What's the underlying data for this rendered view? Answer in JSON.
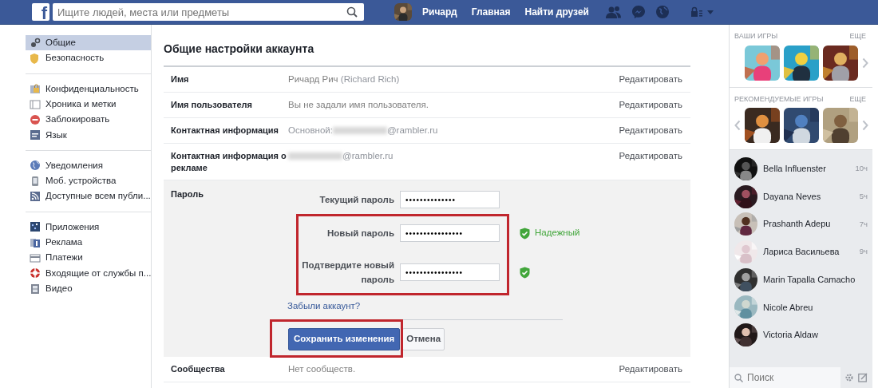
{
  "topbar": {
    "logo": "f",
    "search": {
      "placeholder": "Ищите людей, места или предметы"
    },
    "user": "Ричард",
    "links": [
      "Главная",
      "Найти друзей"
    ]
  },
  "sidebar": {
    "groups": [
      [
        {
          "label": "Общие",
          "selected": true
        },
        {
          "label": "Безопасность",
          "selected": false
        }
      ],
      [
        {
          "label": "Конфиденциальность",
          "selected": false
        },
        {
          "label": "Хроника и метки",
          "selected": false
        },
        {
          "label": "Заблокировать",
          "selected": false
        },
        {
          "label": "Язык",
          "selected": false
        }
      ],
      [
        {
          "label": "Уведомления",
          "selected": false
        },
        {
          "label": "Моб. устройства",
          "selected": false
        },
        {
          "label": "Доступные всем публи...",
          "selected": false
        }
      ],
      [
        {
          "label": "Приложения",
          "selected": false
        },
        {
          "label": "Реклама",
          "selected": false
        },
        {
          "label": "Платежи",
          "selected": false
        },
        {
          "label": "Входящие от службы п...",
          "selected": false
        },
        {
          "label": "Видео",
          "selected": false
        }
      ]
    ]
  },
  "settings": {
    "title": "Общие настройки аккаунта",
    "rows": [
      {
        "label": "Имя",
        "value": "Ричард Рич",
        "note": "(Richard Rich)",
        "action": "Редактировать"
      },
      {
        "label": "Имя пользователя",
        "value": "Вы не задали имя пользователя.",
        "action": "Редактировать"
      },
      {
        "label": "Контактная информация",
        "prefix": "Основной:",
        "redacted": true,
        "suffix": "@rambler.ru",
        "action": "Редактировать"
      },
      {
        "label": "Контактная информация о рекламе",
        "redacted": true,
        "suffix": "@rambler.ru",
        "action": "Редактировать"
      }
    ],
    "password": {
      "label": "Пароль",
      "fields": [
        {
          "label": "Текущий пароль",
          "value": "••••••••••••••",
          "valid": false,
          "highlighted": false
        },
        {
          "label": "Новый пароль",
          "value": "••••••••••••••••",
          "valid": true,
          "strength": "Надежный",
          "highlighted": true
        },
        {
          "label": "Подтвердите новый пароль",
          "value": "••••••••••••••••",
          "valid": true,
          "highlighted": true
        }
      ],
      "forgot_link": "Забыли аккаунт?",
      "save_button": {
        "label": "Сохранить изменения",
        "highlighted": true
      },
      "cancel_button": "Отмена"
    },
    "after_rows": [
      {
        "label": "Сообщества",
        "value": "Нет сообществ.",
        "action": "Редактировать"
      }
    ]
  },
  "games": [
    {
      "heading": "ВАШИ ИГРЫ",
      "more": "ЕЩЕ",
      "prev": false
    },
    {
      "heading": "РЕКОМЕНДУЕМЫЕ ИГРЫ",
      "more": "ЕЩЕ",
      "prev": true
    }
  ],
  "chat": {
    "contacts": [
      {
        "name": "Bella Influenster",
        "time": "10ч"
      },
      {
        "name": "Dayana Neves",
        "time": "5ч"
      },
      {
        "name": "Prashanth Adepu",
        "time": "7ч"
      },
      {
        "name": "Лариса Васильева",
        "time": "9ч"
      },
      {
        "name": "Marin Tapalla Camacho"
      },
      {
        "name": "Nicole Abreu"
      },
      {
        "name": "Victoria Aldaw"
      }
    ],
    "search": {
      "placeholder": "Поиск"
    }
  }
}
